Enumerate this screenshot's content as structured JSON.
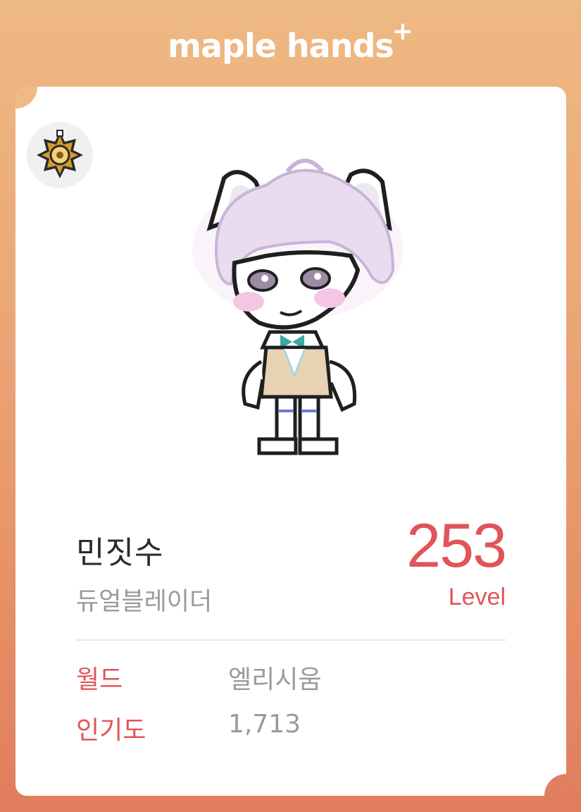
{
  "header": {
    "brand": "maple hands",
    "brand_plus": "+"
  },
  "guild": {
    "emblem_icon": "guild-emblem-icon"
  },
  "character": {
    "avatar_icon": "character-avatar",
    "name": "민짓수",
    "job": "듀얼블레이더",
    "level": "253",
    "level_label": "Level"
  },
  "info": [
    {
      "label": "월드",
      "value": "엘리시움"
    },
    {
      "label": "인기도",
      "value": "1,713"
    }
  ],
  "colors": {
    "accent": "#e0555a",
    "background_top": "#eeb983",
    "background_bottom": "#e07d5e",
    "card": "#ffffff"
  }
}
